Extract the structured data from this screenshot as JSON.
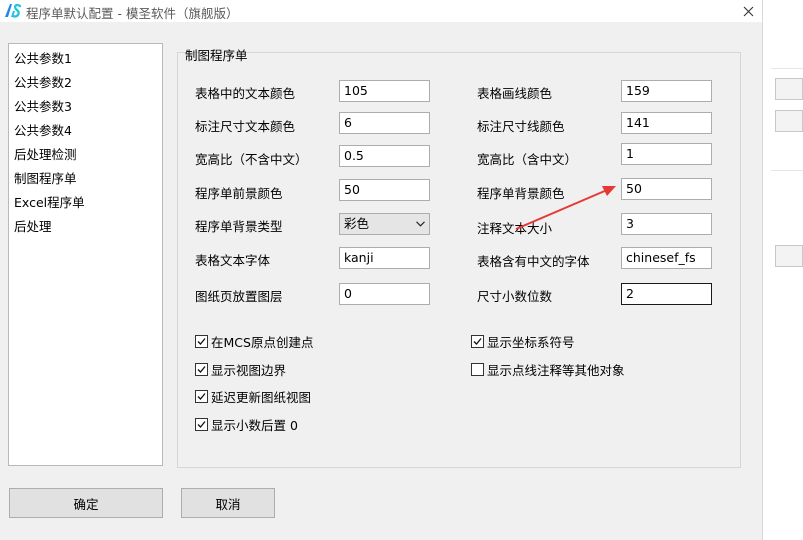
{
  "window": {
    "title": "程序单默认配置 - 模圣软件（旗舰版）"
  },
  "nav": {
    "items": [
      {
        "label": "公共参数1"
      },
      {
        "label": "公共参数2"
      },
      {
        "label": "公共参数3"
      },
      {
        "label": "公共参数4"
      },
      {
        "label": "后处理检测"
      },
      {
        "label": "制图程序单"
      },
      {
        "label": "Excel程序单"
      },
      {
        "label": "后处理"
      }
    ]
  },
  "group": {
    "title": "制图程序单"
  },
  "fields": {
    "table_text_color": {
      "label": "表格中的文本颜色",
      "value": "105"
    },
    "table_line_color": {
      "label": "表格画线颜色",
      "value": "159"
    },
    "dim_text_color": {
      "label": "标注尺寸文本颜色",
      "value": "6"
    },
    "dim_line_color": {
      "label": "标注尺寸线颜色",
      "value": "141"
    },
    "aspect_no_cn": {
      "label": "宽高比（不含中文）",
      "value": "0.5"
    },
    "aspect_cn": {
      "label": "宽高比（含中文）",
      "value": "1"
    },
    "fg_color": {
      "label": "程序单前景颜色",
      "value": "50"
    },
    "bg_color": {
      "label": "程序单背景颜色",
      "value": "50"
    },
    "bg_type": {
      "label": "程序单背景类型",
      "value": "彩色"
    },
    "note_size": {
      "label": "注释文本大小",
      "value": "3"
    },
    "table_font": {
      "label": "表格文本字体",
      "value": "kanji"
    },
    "table_cn_font": {
      "label": "表格含有中文的字体",
      "value": "chinesef_fs"
    },
    "layer": {
      "label": "图纸页放置图层",
      "value": "0"
    },
    "decimals": {
      "label": "尺寸小数位数",
      "value": "2"
    }
  },
  "checks": {
    "mcs_origin": {
      "label": "在MCS原点创建点",
      "checked": true
    },
    "show_csys": {
      "label": "显示坐标系符号",
      "checked": true
    },
    "show_view_border": {
      "label": "显示视图边界",
      "checked": true
    },
    "show_point_notes": {
      "label": "显示点线注释等其他对象",
      "checked": false
    },
    "delay_update": {
      "label": "延迟更新图纸视图",
      "checked": true
    },
    "show_trailing_zero": {
      "label": "显示小数后置 0",
      "checked": true
    }
  },
  "buttons": {
    "ok": "确定",
    "cancel": "取消"
  },
  "colors": {
    "accent_arrow": "#e53935",
    "focus_border": "#1a1a1a"
  }
}
